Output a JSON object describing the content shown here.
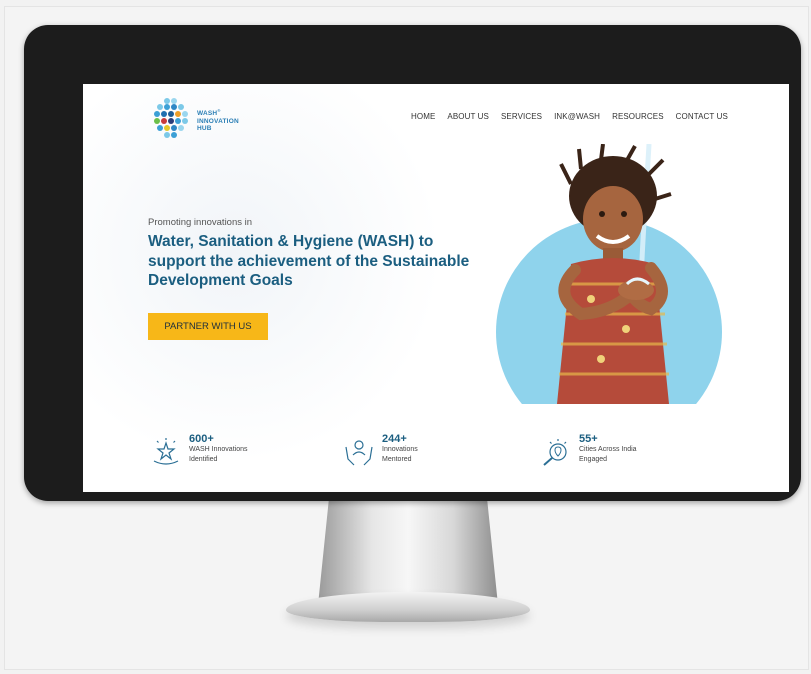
{
  "logo": {
    "line1": "WASH",
    "line2": "INNOVATION",
    "line3": "HUB",
    "mark": "®"
  },
  "nav": {
    "items": [
      "HOME",
      "ABOUT US",
      "SERVICES",
      "INK@WASH",
      "RESOURCES",
      "CONTACT US"
    ]
  },
  "hero": {
    "pre_heading": "Promoting innovations in",
    "headline": "Water, Sanitation & Hygiene (WASH) to support the achievement of the Sustainable Development Goals",
    "cta_label": "PARTNER WITH US"
  },
  "stats": [
    {
      "number": "600+",
      "label": "WASH Innovations Identified",
      "icon": "star-hand-icon"
    },
    {
      "number": "244+",
      "label": "Innovations Mentored",
      "icon": "mentor-hands-icon"
    },
    {
      "number": "55+",
      "label": "Cities Across India Engaged",
      "icon": "search-location-icon"
    }
  ],
  "colors": {
    "brand_blue": "#1b5e80",
    "cta_yellow": "#f7b718",
    "hero_circle": "#8fd3ec"
  }
}
